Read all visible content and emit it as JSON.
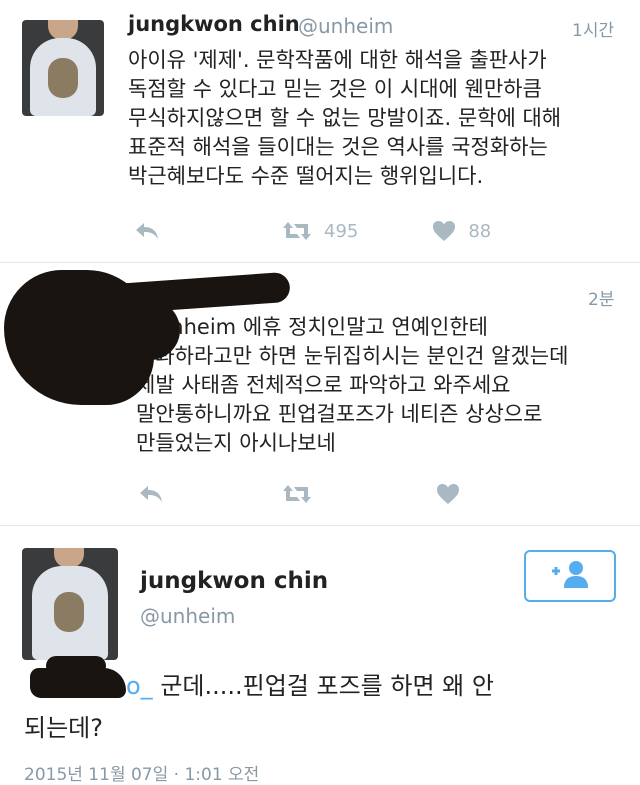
{
  "tweet1": {
    "name": "jungkwon chin",
    "handle": "@unheim",
    "time": "1시간",
    "text": "아이유 '제제'. 문학작품에 대한 해석을 출판사가\n독점할 수 있다고 믿는 것은 이 시대에 웬만하큼\n무식하지않으면 할 수 없는 망발이죠. 문학에 대해\n표준적 해석을 들이대는 것은 역사를 국정화하는\n박근혜보다도 수준 떨어지는 행위입니다.",
    "retweets": "495",
    "likes": "88"
  },
  "tweet2": {
    "time": "2분",
    "text": "@unheim 에휴 정치인말고 연예인한테\n사과하라고만 하면 눈뒤집히시는 분인건 알겠는데\n제발 사태좀 전체적으로 파악하고 와주세요\n말안통하니까요 핀업걸포즈가 네티즌 상상으로\n만들었는지 아시나보네"
  },
  "detail": {
    "name": "jungkwon chin",
    "handle": "@unheim",
    "mention_tail": "o_",
    "text": " 군데.....핀업걸 포즈를 하면 왜 안\n되는데?",
    "date": "2015년 11월 07일 · 1:01 오전"
  },
  "colors": {
    "accent": "#55acee",
    "muted": "#8899a6",
    "icon": "#aab8c2"
  }
}
